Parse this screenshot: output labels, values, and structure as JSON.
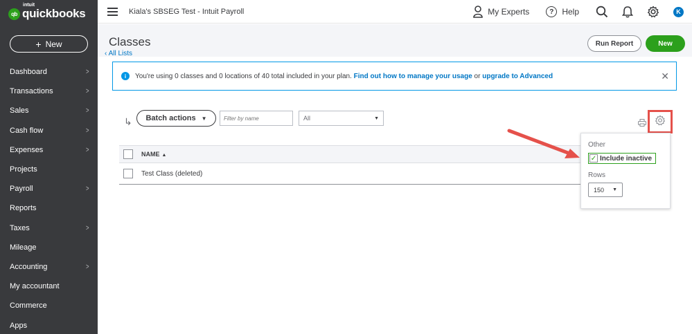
{
  "sidebar": {
    "logo_intuit": "intuit",
    "logo_text": "quickbooks",
    "logo_badge": "qb",
    "new_label": "New",
    "items": [
      {
        "label": "Dashboard",
        "chevron": true
      },
      {
        "label": "Transactions",
        "chevron": true
      },
      {
        "label": "Sales",
        "chevron": true
      },
      {
        "label": "Cash flow",
        "chevron": true
      },
      {
        "label": "Expenses",
        "chevron": true
      },
      {
        "label": "Projects",
        "chevron": false
      },
      {
        "label": "Payroll",
        "chevron": true
      },
      {
        "label": "Reports",
        "chevron": false
      },
      {
        "label": "Taxes",
        "chevron": true
      },
      {
        "label": "Mileage",
        "chevron": false
      },
      {
        "label": "Accounting",
        "chevron": true
      },
      {
        "label": "My accountant",
        "chevron": false
      },
      {
        "label": "Commerce",
        "chevron": false
      },
      {
        "label": "Apps",
        "chevron": false
      }
    ]
  },
  "topbar": {
    "company": "Kiala's SBSEG Test - Intuit Payroll",
    "my_experts": "My Experts",
    "help": "Help",
    "avatar_letter": "K"
  },
  "page": {
    "title": "Classes",
    "all_lists": "All Lists",
    "run_report": "Run Report",
    "new": "New"
  },
  "banner": {
    "text_before": "You're using 0 classes and 0 locations of 40 total included in your plan.",
    "link1": "Find out how to manage your usage",
    "or": "or",
    "link2": "upgrade to Advanced"
  },
  "toolbar": {
    "batch_actions": "Batch actions",
    "filter_placeholder": "Filter by name",
    "status_value": "All"
  },
  "table": {
    "header_name": "NAME",
    "rows": [
      {
        "name": "Test Class (deleted)"
      }
    ]
  },
  "settings_popover": {
    "other_label": "Other",
    "include_inactive_label": "Include inactive",
    "include_inactive_checked": true,
    "rows_label": "Rows",
    "rows_value": "150"
  },
  "colors": {
    "sidebar_bg": "#393a3d",
    "brand_green": "#2ca01c",
    "link_blue": "#0077c5",
    "annotation_red": "#e5514b"
  }
}
